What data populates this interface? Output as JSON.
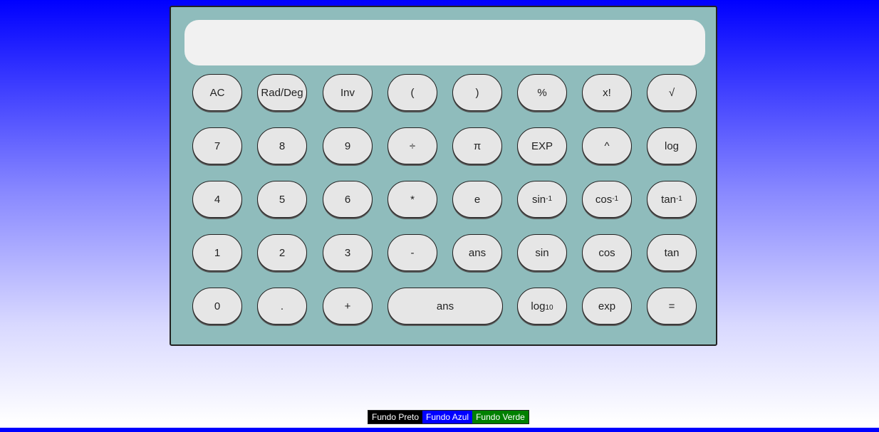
{
  "display": {
    "value": ""
  },
  "keypad": {
    "row1": [
      "AC",
      "Rad/Deg",
      "Inv",
      "(",
      ")",
      "%",
      "x!",
      "√"
    ],
    "row2": [
      "7",
      "8",
      "9",
      "÷",
      "π",
      "EXP",
      "^",
      "log"
    ],
    "row3": {
      "b4": "4",
      "b5": "5",
      "b6": "6",
      "mul": "*",
      "e": "e",
      "asin_base": "sin",
      "asin_sup": "-1",
      "acos_base": "cos",
      "acos_sup": "-1",
      "atan_base": "tan",
      "atan_sup": "-1"
    },
    "row4": [
      "1",
      "2",
      "3",
      "-",
      "ans",
      "sin",
      "cos",
      "tan"
    ],
    "row5": {
      "b0": "0",
      "dot": ".",
      "plus": "+",
      "ans_wide": "ans",
      "log10_base": "log",
      "log10_sub": "10",
      "exp": "exp",
      "equals": "="
    }
  },
  "themes": [
    {
      "label": "Fundo Preto",
      "color": "#000000"
    },
    {
      "label": "Fundo Azul",
      "color": "#0000ff"
    },
    {
      "label": "Fundo Verde",
      "color": "#008000"
    }
  ]
}
